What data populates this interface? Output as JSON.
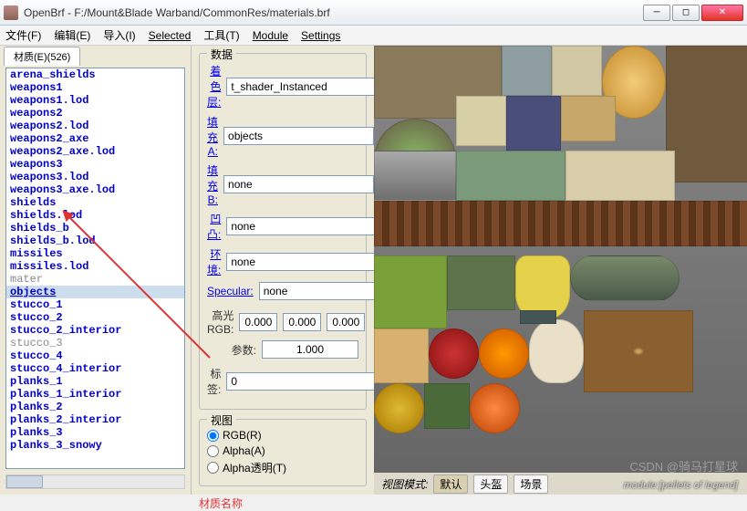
{
  "window": {
    "title": "OpenBrf - F:/Mount&Blade Warband/CommonRes/materials.brf"
  },
  "menu": {
    "file": "文件(F)",
    "edit": "编辑(E)",
    "import": "导入(I)",
    "selected": "Selected",
    "tools": "工具(T)",
    "module": "Module",
    "settings": "Settings"
  },
  "tab": {
    "label": "材质(E)(526)"
  },
  "materials": [
    {
      "name": "arena_shields",
      "dim": false
    },
    {
      "name": "weapons1",
      "dim": false
    },
    {
      "name": "weapons1.lod",
      "dim": false
    },
    {
      "name": "weapons2",
      "dim": false
    },
    {
      "name": "weapons2.lod",
      "dim": false
    },
    {
      "name": "weapons2_axe",
      "dim": false
    },
    {
      "name": "weapons2_axe.lod",
      "dim": false
    },
    {
      "name": "weapons3",
      "dim": false
    },
    {
      "name": "weapons3.lod",
      "dim": false
    },
    {
      "name": "weapons3_axe.lod",
      "dim": false
    },
    {
      "name": "shields",
      "dim": false
    },
    {
      "name": "shields.lod",
      "dim": false
    },
    {
      "name": "shields_b",
      "dim": false
    },
    {
      "name": "shields_b.lod",
      "dim": false
    },
    {
      "name": "missiles",
      "dim": false
    },
    {
      "name": "missiles.lod",
      "dim": false
    },
    {
      "name": "mater",
      "dim": true
    },
    {
      "name": "objects",
      "dim": false,
      "sel": true
    },
    {
      "name": "stucco_1",
      "dim": false
    },
    {
      "name": "stucco_2",
      "dim": false
    },
    {
      "name": "stucco_2_interior",
      "dim": false
    },
    {
      "name": "stucco_3",
      "dim": true
    },
    {
      "name": "stucco_4",
      "dim": false
    },
    {
      "name": "stucco_4_interior",
      "dim": false
    },
    {
      "name": "planks_1",
      "dim": false
    },
    {
      "name": "planks_1_interior",
      "dim": false
    },
    {
      "name": "planks_2",
      "dim": false
    },
    {
      "name": "planks_2_interior",
      "dim": false
    },
    {
      "name": "planks_3",
      "dim": false
    },
    {
      "name": "planks_3_snowy",
      "dim": false
    }
  ],
  "data_panel": {
    "legend": "数据",
    "shader_label": "着色层:",
    "shader_value": "t_shader_Instanced",
    "diffA_label": "填充A:",
    "diffA_value": "objects",
    "diffB_label": "填充B:",
    "diffB_value": "none",
    "bump_label": "凹凸:",
    "bump_value": "none",
    "env_label": "环境:",
    "env_value": "none",
    "spec_label": "Specular:",
    "spec_value": "none",
    "specrgb_label": "高光RGB:",
    "r": "0.000",
    "g": "0.000",
    "b": "0.000",
    "coeff_label": "参数:",
    "coeff_value": "1.000",
    "tag_label": "标签:",
    "tag_value": "0",
    "tag_btn": "..."
  },
  "view_panel": {
    "legend": "视图",
    "rgb": "RGB(R)",
    "alpha": "Alpha(A)",
    "alphat": "Alpha透明(T)"
  },
  "annotation": "材质名称",
  "bottom": {
    "mode_label": "视图模式:",
    "b1": "默认",
    "b2": "头盔",
    "b3": "场景",
    "status": "module:[pellets of legend]"
  },
  "watermark": "CSDN @骑马打星球"
}
